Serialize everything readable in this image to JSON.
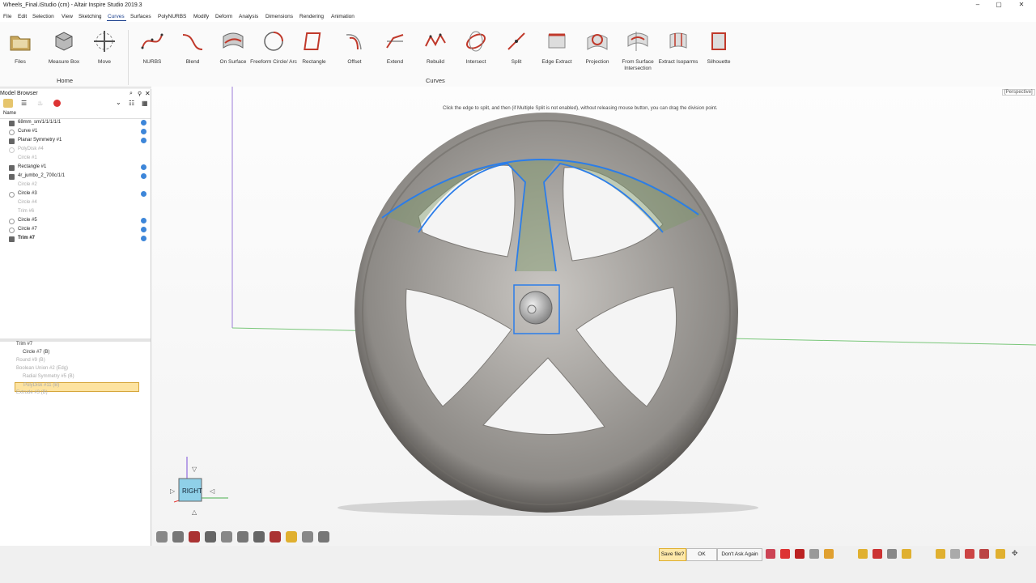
{
  "window": {
    "title": "Wheels_Final.iStudio (cm) - Altair Inspire Studio 2019.3"
  },
  "menu": [
    "File",
    "Edit",
    "Selection",
    "View",
    "Sketching",
    "Curves",
    "Surfaces",
    "PolyNURBS",
    "Modify",
    "Deform",
    "Analysis",
    "Dimensions",
    "Rendering",
    "Animation"
  ],
  "menu_active": "Curves",
  "home_tools": [
    "Files",
    "Measure Box",
    "Move"
  ],
  "home_group": "Home",
  "curve_tools": [
    "NURBS",
    "Blend",
    "On Surface",
    "Freeform Circle/ Arc",
    "Rectangle",
    "Offset",
    "Extend",
    "Rebuild",
    "Intersect",
    "Split",
    "Edge Extract",
    "Projection",
    "From Surface Intersection",
    "Extract Isoparms",
    "Silhouette"
  ],
  "curves_group": "Curves",
  "browser": {
    "title": "Model Browser",
    "col_name": "Name",
    "items": [
      {
        "name": "68mm_sm/1/1/1/1/1",
        "dim": false,
        "checked": true,
        "icon": "sq"
      },
      {
        "name": "Curve #1",
        "dim": false,
        "checked": true,
        "icon": "circ"
      },
      {
        "name": "Planar Symmetry #1",
        "dim": false,
        "checked": true,
        "icon": "sq"
      },
      {
        "name": "PolyDisk #4",
        "dim": true,
        "checked": false,
        "icon": "circ"
      },
      {
        "name": "Circle #1",
        "dim": true,
        "checked": false,
        "icon": "none"
      },
      {
        "name": "Rectangle #1",
        "dim": false,
        "checked": true,
        "icon": "sq"
      },
      {
        "name": "4r_jumbo_2_700c/1/1",
        "dim": false,
        "checked": true,
        "icon": "sq"
      },
      {
        "name": "Circle #2",
        "dim": true,
        "checked": false,
        "icon": "none"
      },
      {
        "name": "Circle #3",
        "dim": false,
        "checked": true,
        "icon": "circ"
      },
      {
        "name": "Circle #4",
        "dim": true,
        "checked": false,
        "icon": "none"
      },
      {
        "name": "Trim #6",
        "dim": true,
        "checked": false,
        "icon": "none"
      },
      {
        "name": "Circle #5",
        "dim": false,
        "checked": true,
        "icon": "circ"
      },
      {
        "name": "Circle #7",
        "dim": false,
        "checked": true,
        "icon": "circ"
      },
      {
        "name": "Trim #7",
        "dim": false,
        "checked": true,
        "icon": "sq"
      }
    ]
  },
  "history": [
    {
      "name": "Trim #7",
      "dim": false,
      "selected": false,
      "indent": 1
    },
    {
      "name": "Circle #7 (B)",
      "dim": false,
      "selected": false,
      "indent": 2
    },
    {
      "name": "Round #9 (B)",
      "dim": true,
      "selected": false,
      "indent": 1
    },
    {
      "name": "Boolean Union #2 (Edg)",
      "dim": true,
      "selected": false,
      "indent": 1
    },
    {
      "name": "Radial Symmetry #5 (B)",
      "dim": true,
      "selected": false,
      "indent": 2
    },
    {
      "name": "PolyDisk #11 (B)",
      "dim": true,
      "selected": true,
      "indent": 2
    },
    {
      "name": "Extrude #3 (B)",
      "dim": true,
      "selected": false,
      "indent": 1
    }
  ],
  "viewport": {
    "hint": "Click the edge to split, and then (if Multiple Split is not enabled), without releasing mouse button, you can drag the division point.",
    "view_mode": "[Perspective]",
    "view_cube_label": "RIGHT"
  },
  "status": {
    "save_prompt": "Save file?",
    "ok": "OK",
    "dont_ask": "Don't Ask Again"
  }
}
